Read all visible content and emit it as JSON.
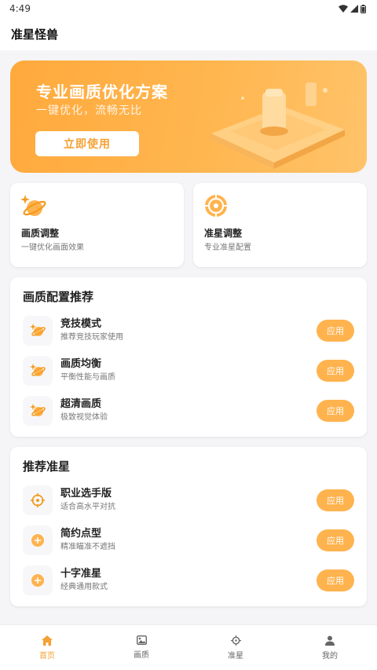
{
  "status_bar": {
    "time": "4:49"
  },
  "app_bar": {
    "title": "准星怪兽"
  },
  "banner": {
    "title": "专业画质优化方案",
    "subtitle": "一键优化，流畅无比",
    "button_label": "立即使用"
  },
  "quick_cards": [
    {
      "title": "画质调整",
      "desc": "一键优化画面效果",
      "icon": "planet-sparkle-icon"
    },
    {
      "title": "准星调整",
      "desc": "专业准星配置",
      "icon": "crosshair-icon"
    }
  ],
  "quality_section": {
    "title": "画质配置推荐",
    "items": [
      {
        "title": "竞技模式",
        "desc": "推荐竞技玩家使用",
        "button": "应用",
        "icon": "planet-icon"
      },
      {
        "title": "画质均衡",
        "desc": "平衡性能与画质",
        "button": "应用",
        "icon": "planet-icon"
      },
      {
        "title": "超清画质",
        "desc": "极致视觉体验",
        "button": "应用",
        "icon": "planet-icon"
      }
    ]
  },
  "crosshair_section": {
    "title": "推荐准星",
    "items": [
      {
        "title": "职业选手版",
        "desc": "适合高水平对抗",
        "button": "应用",
        "icon": "crosshair-icon"
      },
      {
        "title": "简约点型",
        "desc": "精准瞄准不遮挡",
        "button": "应用",
        "icon": "dot-crosshair-icon"
      },
      {
        "title": "十字准星",
        "desc": "经典通用款式",
        "button": "应用",
        "icon": "cross-crosshair-icon"
      }
    ]
  },
  "bottom_nav": [
    {
      "label": "首页",
      "icon": "home-icon",
      "active": true
    },
    {
      "label": "画质",
      "icon": "image-icon",
      "active": false
    },
    {
      "label": "准星",
      "icon": "crosshair-icon",
      "active": false
    },
    {
      "label": "我的",
      "icon": "user-icon",
      "active": false
    }
  ],
  "colors": {
    "accent": "#ffb34e",
    "accent_dark": "#f5a134",
    "background": "#f5f5f7"
  }
}
